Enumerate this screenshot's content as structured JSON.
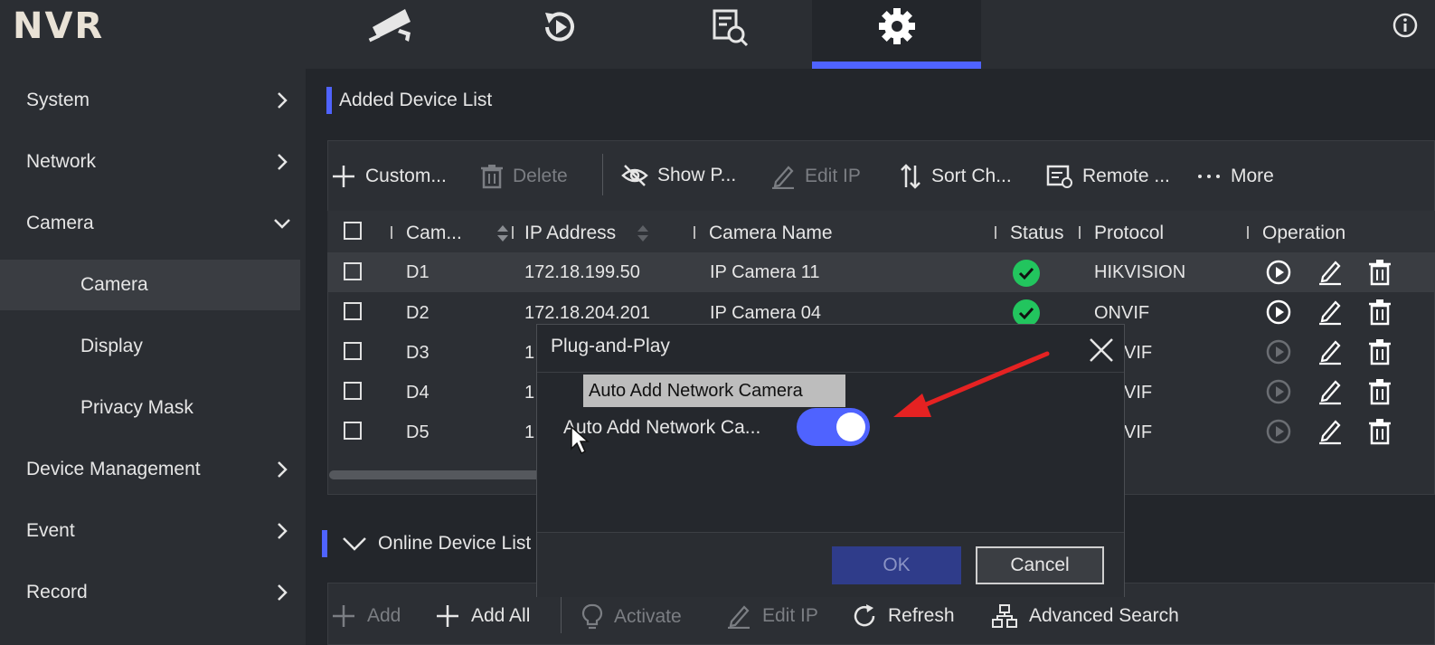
{
  "app": {
    "logo": "NVR"
  },
  "topnav": {
    "tabs": [
      {
        "icon": "camera-icon"
      },
      {
        "icon": "playback-icon"
      },
      {
        "icon": "search-log-icon"
      },
      {
        "icon": "gear-icon",
        "active": true
      }
    ]
  },
  "sidebar": {
    "items": [
      {
        "label": "System"
      },
      {
        "label": "Network"
      },
      {
        "label": "Camera"
      },
      {
        "label": "Camera",
        "selected": true
      },
      {
        "label": "Display"
      },
      {
        "label": "Privacy Mask"
      },
      {
        "label": "Device Management"
      },
      {
        "label": "Event"
      },
      {
        "label": "Record"
      }
    ]
  },
  "added": {
    "title": "Added Device List",
    "toolbar": {
      "custom": "Custom...",
      "delete": "Delete",
      "show_password": "Show P...",
      "edit_ip": "Edit IP",
      "sort": "Sort Ch...",
      "remote": "Remote ...",
      "more": "More"
    },
    "columns": [
      "Cam...",
      "IP Address",
      "Camera Name",
      "Status",
      "Protocol",
      "Operation"
    ],
    "rows": [
      {
        "ch": "D1",
        "ip": "172.18.199.50",
        "name": "IP Camera 11",
        "protocol": "HIKVISION"
      },
      {
        "ch": "D2",
        "ip": "172.18.204.201",
        "name": "IP Camera 04",
        "protocol": "ONVIF"
      },
      {
        "ch": "D3",
        "ip": "1",
        "name": "",
        "protocol": "VIF"
      },
      {
        "ch": "D4",
        "ip": "1",
        "name": "",
        "protocol": "VIF"
      },
      {
        "ch": "D5",
        "ip": "1",
        "name": "",
        "protocol": "VIF"
      }
    ]
  },
  "online": {
    "title": "Online Device List",
    "toolbar": {
      "add": "Add",
      "add_all": "Add All",
      "activate": "Activate",
      "edit_ip": "Edit IP",
      "refresh": "Refresh",
      "advanced": "Advanced Search"
    }
  },
  "dialog": {
    "title": "Plug-and-Play",
    "tooltip": "Auto Add Network Camera",
    "label": "Auto Add Network Ca...",
    "ok": "OK",
    "cancel": "Cancel"
  },
  "colors": {
    "accent": "#4f63ff",
    "status_ok": "#22c55e",
    "annotation_arrow": "#e52222"
  }
}
